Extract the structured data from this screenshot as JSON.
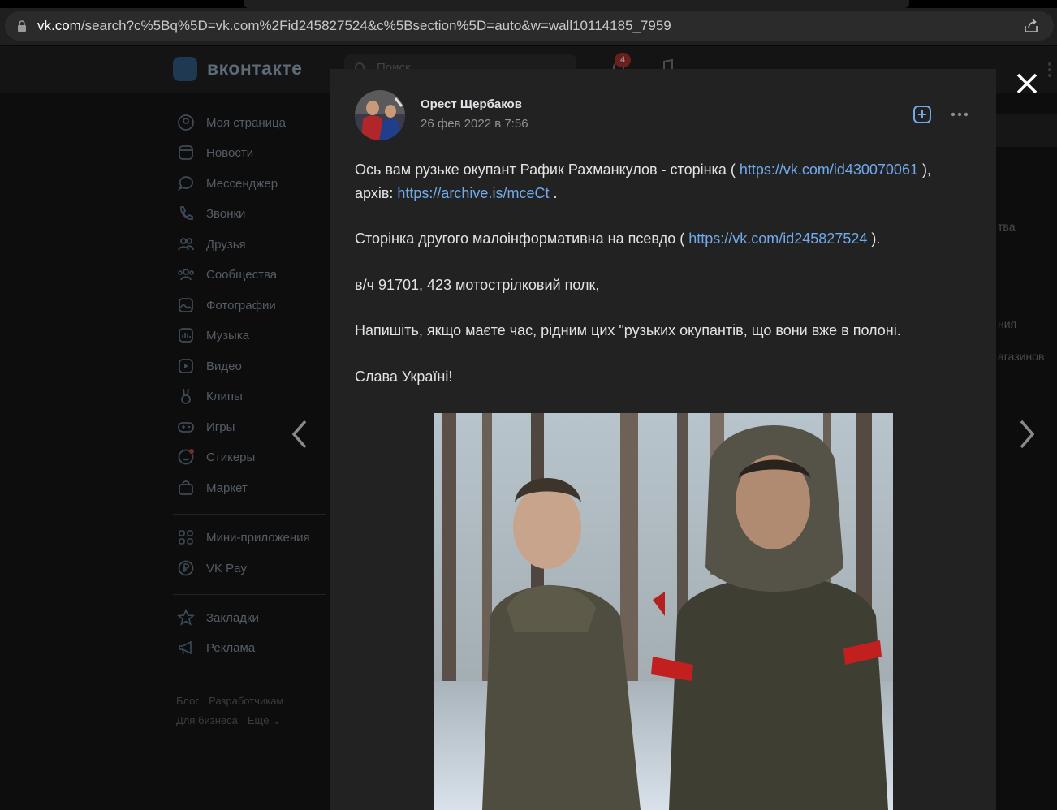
{
  "browser": {
    "url_domain": "vk.com",
    "url_rest": "/search?c%5Bq%5D=vk.com%2Fid245827524&c%5Bsection%5D=auto&w=wall10114185_7959"
  },
  "vk": {
    "logo_text": "вконтакте",
    "search_placeholder": "Поиск",
    "notifications_count": "4",
    "sidebar": [
      {
        "label": "Моя страница",
        "icon": "user-circle-icon"
      },
      {
        "label": "Новости",
        "icon": "news-icon"
      },
      {
        "label": "Мессенджер",
        "icon": "message-icon"
      },
      {
        "label": "Звонки",
        "icon": "phone-icon"
      },
      {
        "label": "Друзья",
        "icon": "friends-icon"
      },
      {
        "label": "Сообщества",
        "icon": "communities-icon"
      },
      {
        "label": "Фотографии",
        "icon": "photos-icon"
      },
      {
        "label": "Музыка",
        "icon": "music-icon"
      },
      {
        "label": "Видео",
        "icon": "video-icon"
      },
      {
        "label": "Клипы",
        "icon": "clips-icon"
      },
      {
        "label": "Игры",
        "icon": "games-icon"
      },
      {
        "label": "Стикеры",
        "icon": "stickers-icon"
      },
      {
        "label": "Маркет",
        "icon": "market-icon"
      },
      {
        "label": "Мини-приложения",
        "icon": "mini-apps-icon"
      },
      {
        "label": "VK Pay",
        "icon": "vk-pay-icon"
      },
      {
        "label": "Закладки",
        "icon": "bookmark-star-icon"
      },
      {
        "label": "Реклама",
        "icon": "megaphone-icon"
      }
    ],
    "footer": {
      "blog": "Блог",
      "developers": "Разработчикам",
      "business": "Для бизнеса",
      "more": "Ещё"
    },
    "right_fragments": [
      "тва",
      "ния",
      "агазинов"
    ]
  },
  "post": {
    "author": "Орест Щербаков",
    "date": "26 фев 2022 в 7:56",
    "p1_text_a": "Ось вам рузьке окупант Рафик Рахманкулов - сторінка ( ",
    "p1_link_a": "https://vk.com/id430070061",
    "p1_text_b": " ),",
    "p1_text_c": "архів: ",
    "p1_link_b": "https://archive.is/mceCt",
    "p1_text_d": " .",
    "p2_text_a": "Сторінка другого малоінформативна на псевдо ( ",
    "p2_link": "https://vk.com/id245827524",
    "p2_text_b": " ).",
    "p3": "в/ч 91701, 423 мотострілковий полк,",
    "p4": "Напишіть, якщо маєте час, рідним цих \"рузьких окупантів, що вони вже в полоні.",
    "p5": "Слава Україні!"
  },
  "colors": {
    "modal_bg": "#222222",
    "link": "#71aaeb",
    "text": "#e1e3e6",
    "secondary_text": "#939393"
  }
}
